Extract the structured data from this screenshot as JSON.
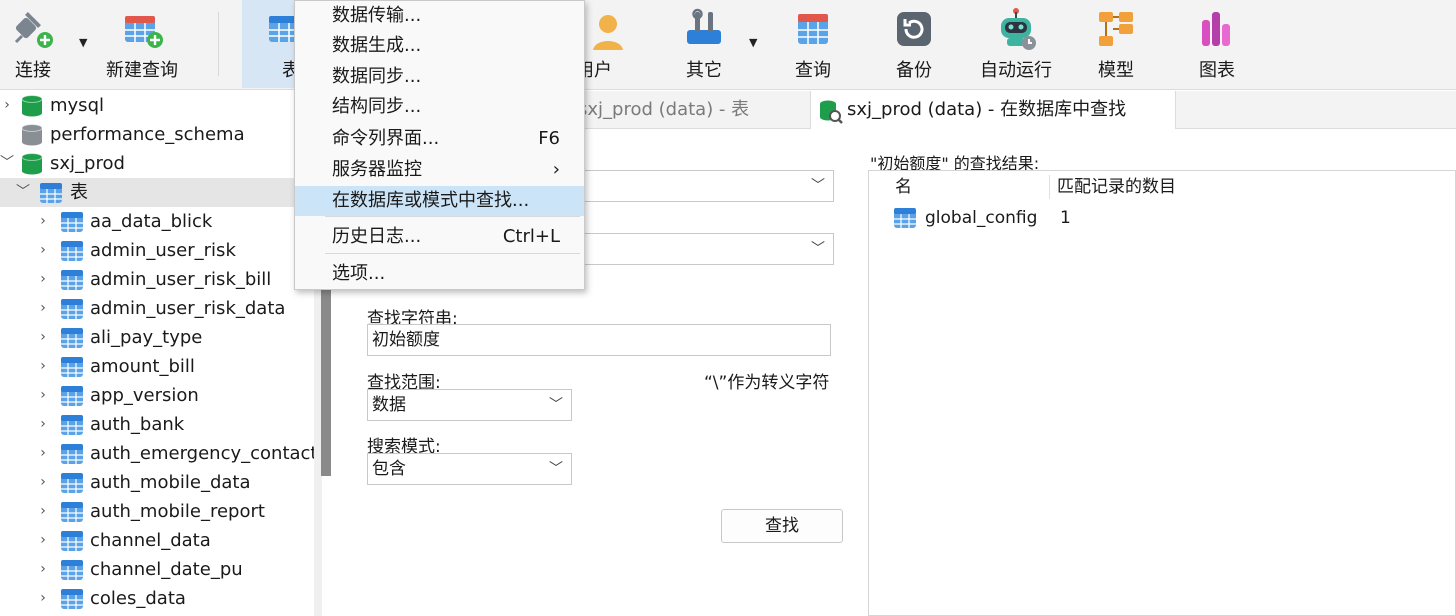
{
  "toolbar": {
    "connect": "连接",
    "new_query": "新建查询",
    "table": "表",
    "user": "用户",
    "other": "其它",
    "query": "查询",
    "backup": "备份",
    "autorun": "自动运行",
    "model": "模型",
    "chart": "图表"
  },
  "tree": [
    {
      "label": "mysql",
      "icon": "database-green-icon",
      "expanded": false
    },
    {
      "label": "performance_schema",
      "icon": "database-gray-icon",
      "expanded": false
    },
    {
      "label": "sxj_prod",
      "icon": "database-green-icon",
      "expanded": true
    },
    {
      "label": "表",
      "icon": "table-folder-icon",
      "expanded": true
    },
    {
      "label": "aa_data_blick"
    },
    {
      "label": "admin_user_risk"
    },
    {
      "label": "admin_user_risk_bill"
    },
    {
      "label": "admin_user_risk_data"
    },
    {
      "label": "ali_pay_type"
    },
    {
      "label": "amount_bill"
    },
    {
      "label": "app_version"
    },
    {
      "label": "auth_bank"
    },
    {
      "label": "auth_emergency_contact"
    },
    {
      "label": "auth_mobile_data"
    },
    {
      "label": "auth_mobile_report"
    },
    {
      "label": "channel_data"
    },
    {
      "label": "channel_date_pu"
    },
    {
      "label": "coles_data"
    }
  ],
  "tabs": [
    {
      "label": "sxj_prod (data) - 表"
    },
    {
      "label": "sxj_prod (data) - 在数据库中查找"
    }
  ],
  "menu": {
    "items": [
      {
        "label": "数据传输...",
        "shortcut": ""
      },
      {
        "label": "数据生成...",
        "shortcut": ""
      },
      {
        "label": "数据同步...",
        "shortcut": ""
      },
      {
        "label": "结构同步...",
        "shortcut": ""
      },
      {
        "label": "命令列界面...",
        "shortcut": "F6"
      },
      {
        "label": "服务器监控",
        "shortcut": "›"
      },
      {
        "label": "在数据库或模式中查找...",
        "shortcut": ""
      },
      {
        "label": "历史日志...",
        "shortcut": "Ctrl+L"
      },
      {
        "label": "选项...",
        "shortcut": ""
      }
    ]
  },
  "find_panel": {
    "search_string_label": "查找字符串:",
    "search_string_value": "初始额度",
    "scope_label": "查找范围:",
    "escape_note": "“\\”作为转义字符",
    "scope_value": "数据",
    "mode_label": "搜索模式:",
    "mode_value": "包含",
    "find_button": "查找"
  },
  "results": {
    "title": "\"初始额度\" 的查找结果:",
    "col_name": "名",
    "col_count": "匹配记录的数目",
    "rows": [
      {
        "name": "global_config",
        "count": "1"
      }
    ]
  },
  "colors": {
    "accent_blue": "#2d7fd8",
    "db_green": "#1e9e4a",
    "menu_highlight": "#cce4f7"
  }
}
